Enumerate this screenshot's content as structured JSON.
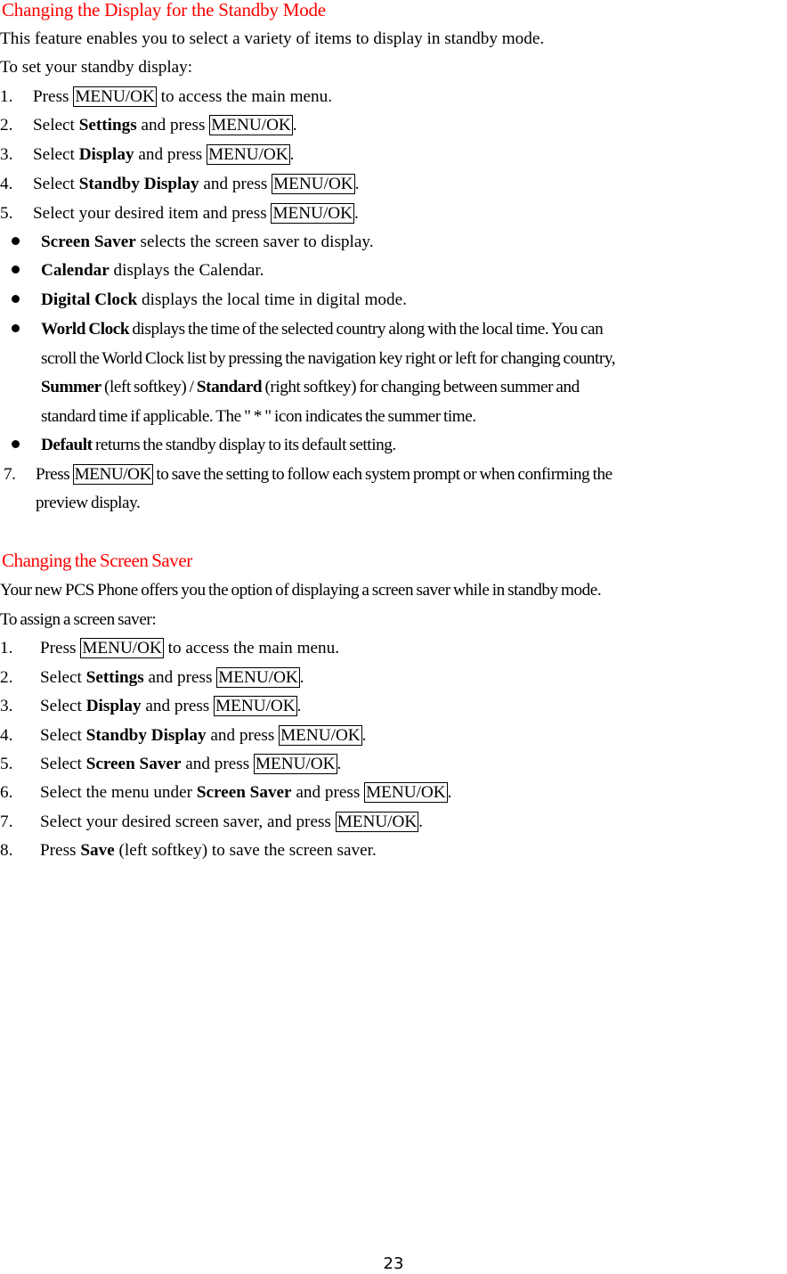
{
  "section1": {
    "title": "Changing the Display for the Standby Mode",
    "intro": "This feature enables you to select a variety of items to display in standby mode.",
    "lead": "To set your standby display:",
    "steps": [
      {
        "num": "1.",
        "pre": "Press ",
        "key": "MENU/OK",
        "post": " to access the main menu."
      },
      {
        "num": "2.",
        "pre": "Select ",
        "bold": "Settings",
        "mid": " and press ",
        "key": "MENU/OK",
        "post": "."
      },
      {
        "num": "3.",
        "pre": "Select ",
        "bold": "Display",
        "mid": " and press ",
        "key": "MENU/OK",
        "post": "."
      },
      {
        "num": "4.",
        "pre": "Select ",
        "bold": "Standby Display",
        "mid": " and press ",
        "key": "MENU/OK",
        "post": "."
      },
      {
        "num": "5.",
        "pre": "Select your desired item and press ",
        "key": "MENU/OK",
        "post": "."
      }
    ],
    "bullets": [
      {
        "bold": "Screen Saver",
        "text": " selects the screen saver to display."
      },
      {
        "bold": "Calendar",
        "text": " displays the Calendar."
      },
      {
        "bold": "Digital Clock",
        "text": " displays the local time in digital mode."
      },
      {
        "bold": "World Clock",
        "text": " displays the time of the selected country along with the local time. You can",
        "line2": "scroll the World Clock list by pressing the navigation key right or left for changing country,",
        "bold3a": "Summer",
        "text3a": " (left softkey) / ",
        "bold3b": "Standard",
        "text3b": " (right softkey) for changing between summer and",
        "line4": "standard time if applicable. The \" * \" icon indicates the summer time."
      },
      {
        "bold": "Default",
        "text": " returns the standby display to its default setting."
      }
    ],
    "step7": {
      "num": "7.",
      "pre": "Press ",
      "key": "MENU/OK",
      "post": " to save the setting to follow each system prompt or when confirming the",
      "line2": "preview display."
    }
  },
  "section2": {
    "title": "Changing the Screen Saver",
    "intro": "Your new PCS Phone offers you the option of displaying a screen saver while in standby mode.",
    "lead": "To assign a screen saver:",
    "steps": [
      {
        "num": "1.",
        "pre": "Press ",
        "key": "MENU/OK",
        "post": " to access the main menu."
      },
      {
        "num": "2.",
        "pre": "Select ",
        "bold": "Settings",
        "mid": " and press ",
        "key": "MENU/OK",
        "post": "."
      },
      {
        "num": "3.",
        "pre": "Select ",
        "bold": "Display",
        "mid": " and press ",
        "key": "MENU/OK",
        "post": "."
      },
      {
        "num": "4.",
        "pre": "Select ",
        "bold": "Standby Display",
        "mid": " and press ",
        "key": "MENU/OK",
        "post": "."
      },
      {
        "num": "5.",
        "pre": "Select ",
        "bold": "Screen Saver",
        "mid": " and press ",
        "key": "MENU/OK",
        "post": "."
      },
      {
        "num": "6.",
        "pre": "Select the menu under ",
        "bold": "Screen Saver",
        "mid": " and press ",
        "key": "MENU/OK",
        "post": "."
      },
      {
        "num": "7.",
        "pre": "Select your desired screen saver, and press ",
        "key": "MENU/OK",
        "post": "."
      },
      {
        "num": "8.",
        "pre": "Press ",
        "bold": "Save",
        "mid": " (left softkey) to save the screen saver.",
        "post": ""
      }
    ]
  },
  "footer": {
    "page_number": "23"
  }
}
